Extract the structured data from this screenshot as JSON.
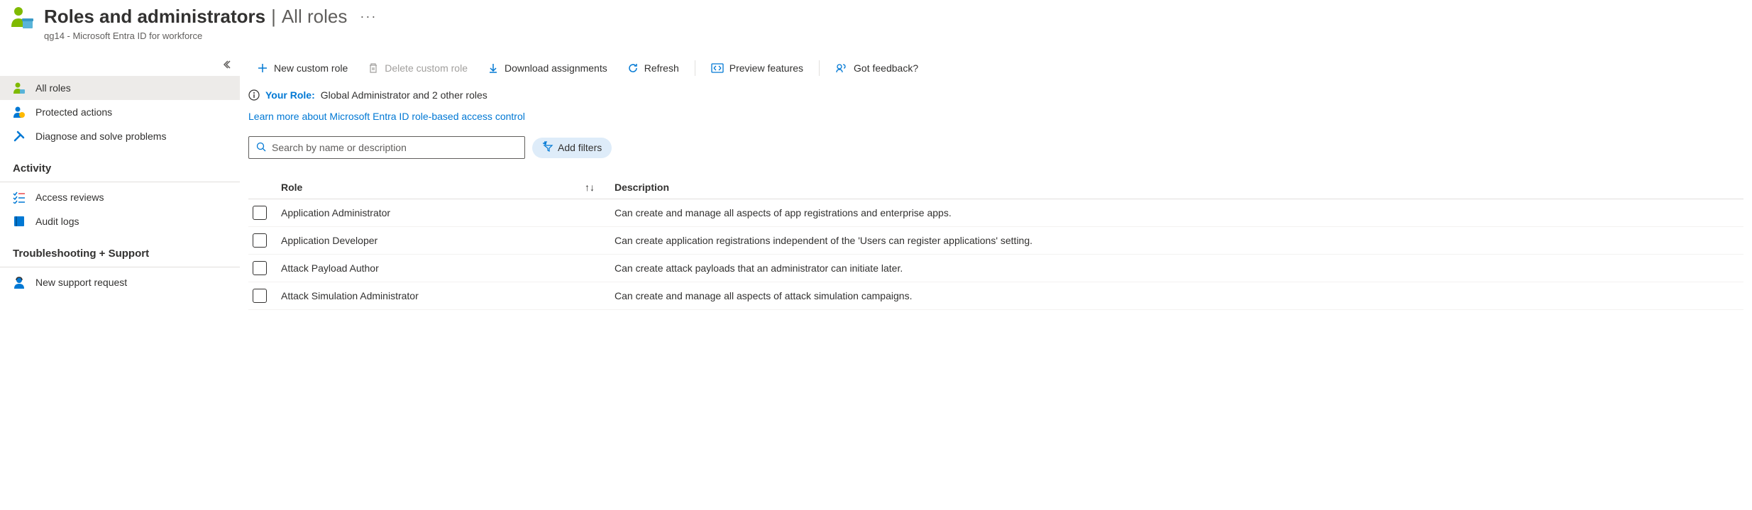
{
  "header": {
    "title_main": "Roles and administrators",
    "title_separator": "|",
    "title_sub": "All roles",
    "subtitle": "qg14 - Microsoft Entra ID for workforce"
  },
  "sidebar": {
    "items": [
      {
        "label": "All roles",
        "active": true,
        "icon": "person"
      },
      {
        "label": "Protected actions",
        "active": false,
        "icon": "shield-person"
      },
      {
        "label": "Diagnose and solve problems",
        "active": false,
        "icon": "wrench"
      }
    ],
    "section_activity": "Activity",
    "activity_items": [
      {
        "label": "Access reviews",
        "icon": "checklist"
      },
      {
        "label": "Audit logs",
        "icon": "book"
      }
    ],
    "section_troubleshoot": "Troubleshooting + Support",
    "troubleshoot_items": [
      {
        "label": "New support request",
        "icon": "support-person"
      }
    ]
  },
  "toolbar": {
    "new_custom_role": "New custom role",
    "delete_custom_role": "Delete custom role",
    "download_assignments": "Download assignments",
    "refresh": "Refresh",
    "preview_features": "Preview features",
    "got_feedback": "Got feedback?"
  },
  "role_bar": {
    "label": "Your Role:",
    "value": "Global Administrator and 2 other roles"
  },
  "learn_link": "Learn more about Microsoft Entra ID role-based access control",
  "filters": {
    "search_placeholder": "Search by name or description",
    "add_filters": "Add filters"
  },
  "table": {
    "col_role": "Role",
    "col_desc": "Description",
    "rows": [
      {
        "role": "Application Administrator",
        "desc": "Can create and manage all aspects of app registrations and enterprise apps."
      },
      {
        "role": "Application Developer",
        "desc": "Can create application registrations independent of the 'Users can register applications' setting."
      },
      {
        "role": "Attack Payload Author",
        "desc": "Can create attack payloads that an administrator can initiate later."
      },
      {
        "role": "Attack Simulation Administrator",
        "desc": "Can create and manage all aspects of attack simulation campaigns."
      }
    ]
  }
}
